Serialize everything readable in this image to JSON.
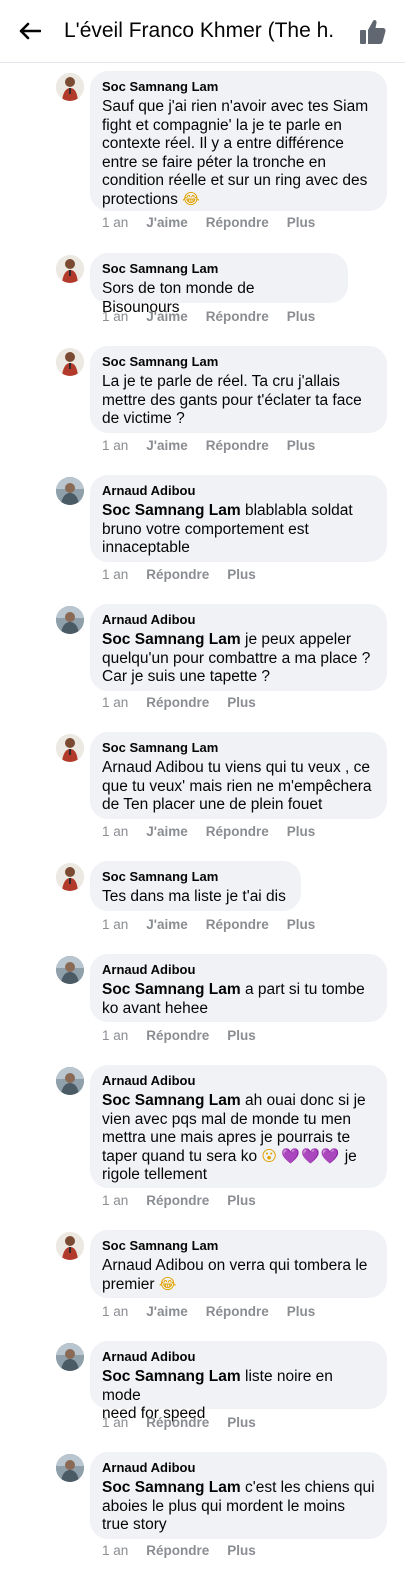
{
  "header": {
    "title": "L'éveil Franco Khmer (The h...",
    "back_icon": "arrow-left-icon",
    "like_icon": "thumbs-up-icon"
  },
  "comments": [
    {
      "author": "Soc Samnang Lam",
      "avatar": "soc",
      "mention": "",
      "text_lines": [
        "Sauf que j'ai rien n'avoir avec tes Siam",
        "fight et compagnie' la je te parle en",
        "contexte réel. Il y a entre différence",
        "entre se faire péter la tronche en",
        "condition réelle et sur un ring avec des",
        "protections"
      ],
      "emoji_end": "😂",
      "time": "1 an",
      "like": "J'aime",
      "reply": "Répondre",
      "more": "Plus"
    },
    {
      "author": "Soc Samnang Lam",
      "avatar": "soc",
      "text_lines": [
        "Sors de ton monde de Bisounours"
      ],
      "time": "1 an",
      "like": "J'aime",
      "reply": "Répondre",
      "more": "Plus"
    },
    {
      "author": "Soc Samnang Lam",
      "avatar": "soc",
      "text_lines": [
        "La je te parle de réel. Ta cru j'allais",
        "mettre des gants pour t'éclater ta face",
        "de victime ?"
      ],
      "time": "1 an",
      "like": "J'aime",
      "reply": "Répondre",
      "more": "Plus"
    },
    {
      "author": "Arnaud Adibou",
      "avatar": "arn",
      "mention": "Soc Samnang Lam",
      "text_lines": [
        " blablabla soldat",
        "bruno votre comportement est",
        "innaceptable"
      ],
      "time": "1 an",
      "reply": "Répondre",
      "more": "Plus"
    },
    {
      "author": "Arnaud Adibou",
      "avatar": "arn",
      "mention": "Soc Samnang Lam",
      "text_lines": [
        " je peux appeler",
        "quelqu'un pour combattre a ma place ?",
        "Car je suis une tapette ?"
      ],
      "time": "1 an",
      "reply": "Répondre",
      "more": "Plus"
    },
    {
      "author": "Soc Samnang Lam",
      "avatar": "soc",
      "text_lines": [
        "Arnaud Adibou tu viens qui tu veux , ce",
        "que tu veux' mais rien ne m'empêchera",
        "de Ten placer une de plein fouet"
      ],
      "time": "1 an",
      "like": "J'aime",
      "reply": "Répondre",
      "more": "Plus"
    },
    {
      "author": "Soc Samnang Lam",
      "avatar": "soc",
      "text_lines": [
        "Tes dans ma liste je t'ai dis"
      ],
      "time": "1 an",
      "like": "J'aime",
      "reply": "Répondre",
      "more": "Plus"
    },
    {
      "author": "Arnaud Adibou",
      "avatar": "arn",
      "mention": "Soc Samnang Lam",
      "text_lines": [
        " a part si tu tombe",
        "ko avant hehee"
      ],
      "time": "1 an",
      "reply": "Répondre",
      "more": "Plus"
    },
    {
      "author": "Arnaud Adibou",
      "avatar": "arn",
      "mention": "Soc Samnang Lam",
      "text_lines": [
        " ah ouai donc si je",
        "vien avec pqs mal de monde tu men",
        "mettra une mais apres je pourrais te",
        "taper quand tu sera ko",
        "rigole tellement"
      ],
      "emoji_mid": "😮",
      "emoji_hearts": "💜💜💜",
      "emoji_tail": " je",
      "time": "1 an",
      "reply": "Répondre",
      "more": "Plus"
    },
    {
      "author": "Soc Samnang Lam",
      "avatar": "soc",
      "text_lines": [
        "Arnaud Adibou on verra qui tombera le",
        "premier"
      ],
      "emoji_end": "😂",
      "time": "1 an",
      "like": "J'aime",
      "reply": "Répondre",
      "more": "Plus"
    },
    {
      "author": "Arnaud Adibou",
      "avatar": "arn",
      "mention": "Soc Samnang Lam",
      "text_lines": [
        " liste noire en mode",
        "need for speed"
      ],
      "time": "1 an",
      "reply": "Répondre",
      "more": "Plus"
    },
    {
      "author": "Arnaud Adibou",
      "avatar": "arn",
      "mention": "Soc Samnang Lam",
      "text_lines": [
        " c'est les chiens qui",
        "aboies le plus qui mordent le moins",
        "true story"
      ],
      "time": "1 an",
      "reply": "Répondre",
      "more": "Plus"
    }
  ],
  "colors": {
    "bubble": "#f0f2f5",
    "meta_text": "#8a8d91",
    "divider": "#e4e6eb"
  }
}
